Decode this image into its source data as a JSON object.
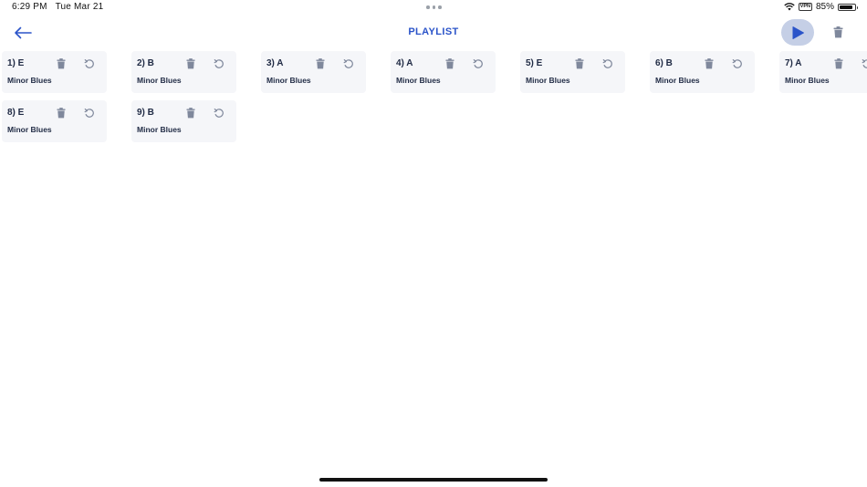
{
  "status": {
    "time": "6:29 PM",
    "date": "Tue Mar 21",
    "vpn": "VPN",
    "battery": "85%",
    "battery_level": 0.85
  },
  "header": {
    "title": "PLAYLIST"
  },
  "icons": {
    "back": "arrow-left-icon",
    "play": "play-icon",
    "clear": "trash-icon",
    "delete": "trash-icon",
    "reset": "rotate-ccw-icon"
  },
  "colors": {
    "accent": "#2b54c9",
    "card_bg": "#f5f6f9",
    "icon_gray": "#7f889c",
    "play_bg": "#c5cfe6"
  },
  "playlist": [
    {
      "title": "1) E",
      "subtitle": "Minor Blues"
    },
    {
      "title": "2) B",
      "subtitle": "Minor Blues"
    },
    {
      "title": "3) A",
      "subtitle": "Minor Blues"
    },
    {
      "title": "4) A",
      "subtitle": "Minor Blues"
    },
    {
      "title": "5) E",
      "subtitle": "Minor Blues"
    },
    {
      "title": "6) B",
      "subtitle": "Minor Blues"
    },
    {
      "title": "7) A",
      "subtitle": "Minor Blues"
    },
    {
      "title": "8) E",
      "subtitle": "Minor Blues"
    },
    {
      "title": "9) B",
      "subtitle": "Minor Blues"
    }
  ]
}
